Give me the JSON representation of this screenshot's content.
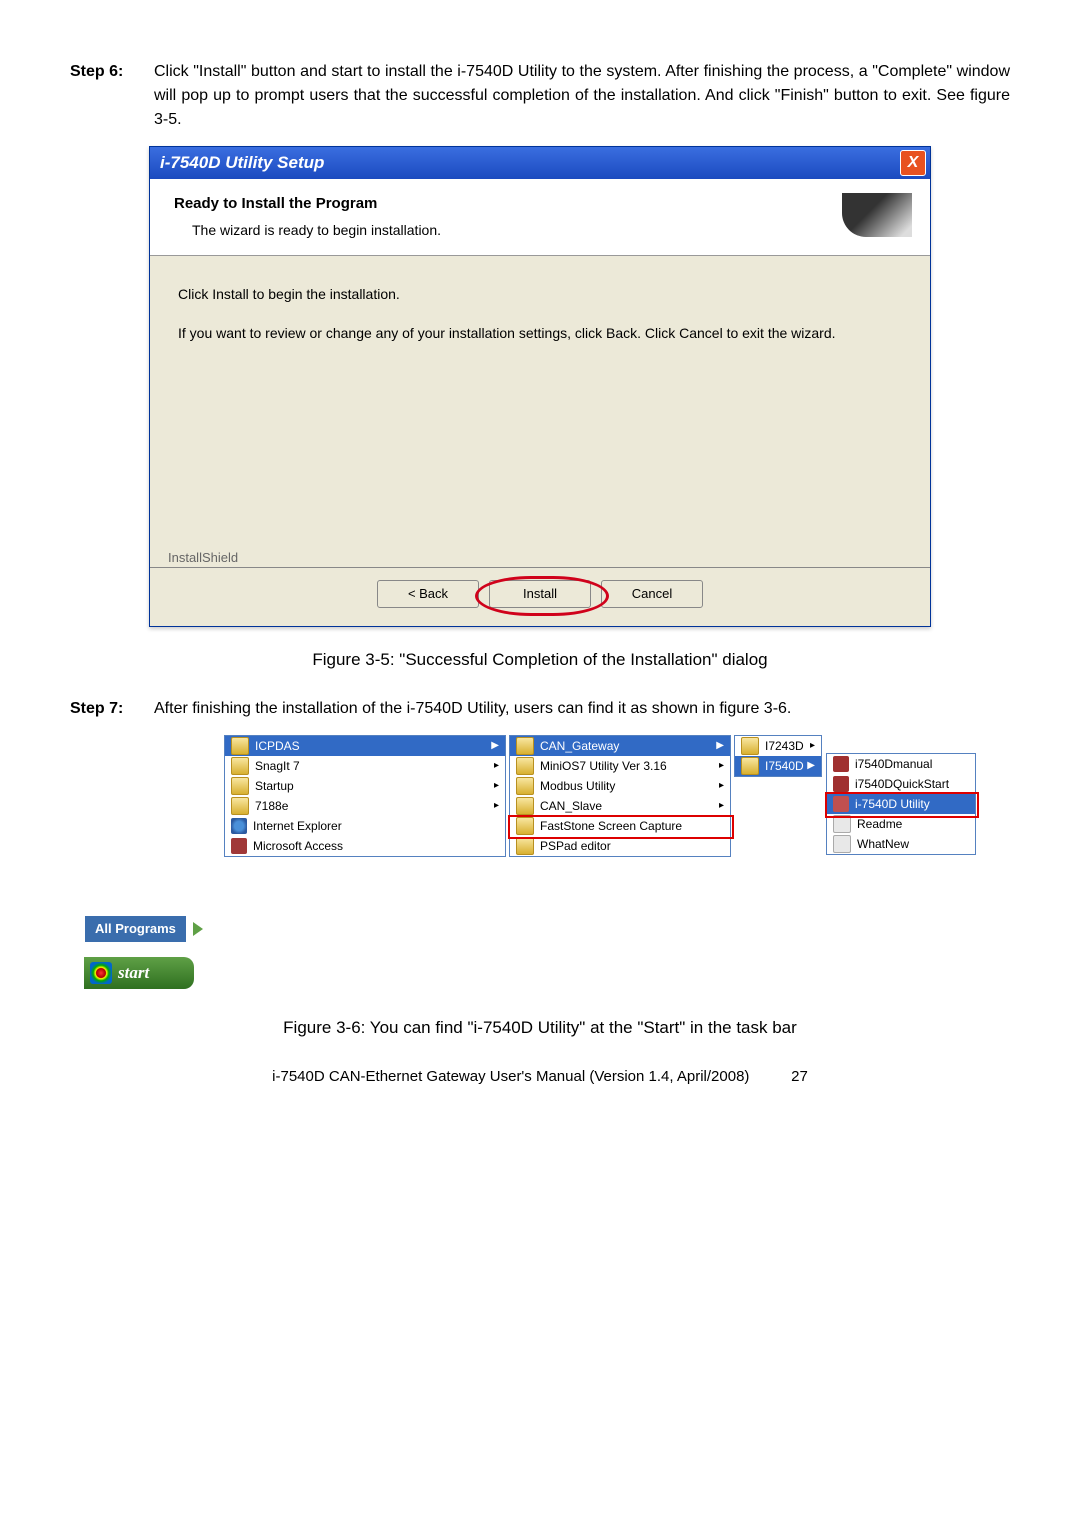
{
  "step6": {
    "label": "Step 6:",
    "text": "Click \"Install\" button and start to install the i-7540D Utility to the system. After finishing the process, a \"Complete\" window will pop up to prompt users that the successful completion of the installation. And click \"Finish\" button to exit. See figure 3-5."
  },
  "dialog": {
    "title": "i-7540D Utility Setup",
    "close": "X",
    "header_title": "Ready to Install the Program",
    "header_sub": "The wizard is ready to begin installation.",
    "body_line1": "Click Install to begin the installation.",
    "body_line2": "If you want to review or change any of your installation settings, click Back. Click Cancel to exit the wizard.",
    "footer_label": "InstallShield",
    "btn_back": "< Back",
    "btn_install": "Install",
    "btn_cancel": "Cancel"
  },
  "figure35": "Figure 3-5: \"Successful Completion of the Installation\" dialog",
  "step7": {
    "label": "Step 7:",
    "text": "After finishing the installation of the i-7540D Utility, users can find it as shown in figure 3-6."
  },
  "menus": {
    "col1": [
      {
        "label": "ICPDAS",
        "hl": true,
        "arrow": true,
        "icon": "folder"
      },
      {
        "label": "SnagIt 7",
        "arrow": true,
        "icon": "folder"
      },
      {
        "label": "Startup",
        "arrow": true,
        "icon": "folder"
      },
      {
        "label": "7188e",
        "arrow": true,
        "icon": "folder"
      },
      {
        "label": "Internet Explorer",
        "icon": "ie-icon"
      },
      {
        "label": "Microsoft Access",
        "icon": "access"
      }
    ],
    "col2": [
      {
        "label": "CAN_Gateway",
        "hl": true,
        "arrow": true,
        "icon": "folder"
      },
      {
        "label": "MiniOS7 Utility Ver 3.16",
        "arrow": true,
        "icon": "folder"
      },
      {
        "label": "Modbus Utility",
        "arrow": true,
        "icon": "folder"
      },
      {
        "label": "CAN_Slave",
        "arrow": true,
        "icon": "folder"
      },
      {
        "label": "FastStone Screen Capture",
        "icon": "folder"
      },
      {
        "label": "PSPad editor",
        "icon": "folder"
      }
    ],
    "col3": [
      {
        "label": "I7243D",
        "arrow": true,
        "icon": "folder"
      },
      {
        "label": "I7540D",
        "hl": true,
        "arrow": true,
        "icon": "folder"
      }
    ],
    "col4": [
      {
        "label": "i7540Dmanual",
        "icon": "pdf"
      },
      {
        "label": "i7540DQuickStart",
        "icon": "pdf"
      },
      {
        "label": "i-7540D Utility",
        "hl": true,
        "icon": "util"
      },
      {
        "label": "Readme",
        "icon": "txt"
      },
      {
        "label": "WhatNew",
        "icon": "txt"
      }
    ],
    "all_programs": "All Programs",
    "start": "start"
  },
  "figure36": "Figure 3-6: You can find \"i-7540D Utility\" at the \"Start\" in the task bar",
  "footer": {
    "text": "i-7540D CAN-Ethernet Gateway User's Manual (Version 1.4, April/2008)",
    "page": "27"
  }
}
